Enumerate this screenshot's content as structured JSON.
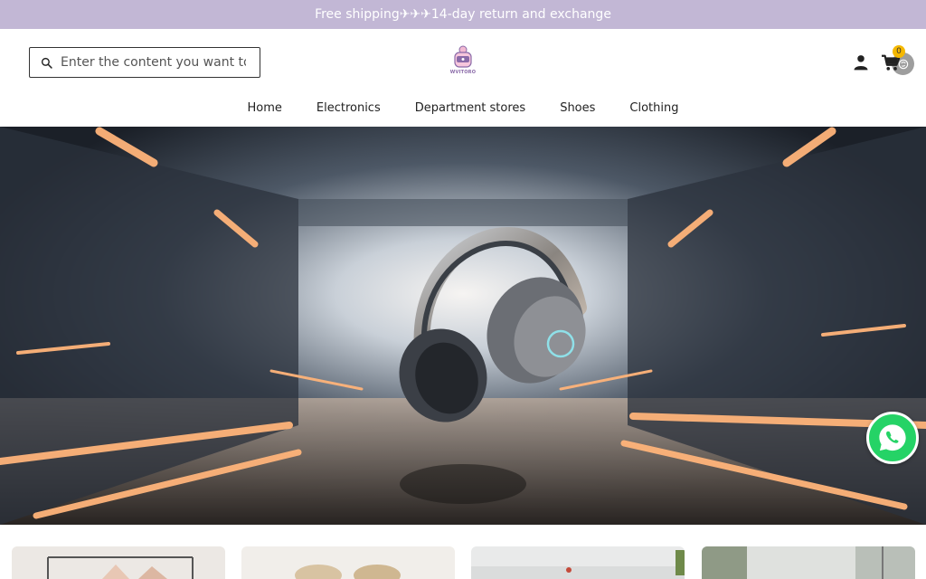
{
  "announcement": "Free shipping✈✈✈14-day return and exchange",
  "search": {
    "placeholder": "Enter the content you want to search"
  },
  "logo": {
    "text": "WVITORO"
  },
  "cart": {
    "count": "0"
  },
  "nav": {
    "items": [
      "Home",
      "Electronics",
      "Department stores",
      "Shoes",
      "Clothing"
    ]
  },
  "icons": {
    "search": "search-icon",
    "user": "user-icon",
    "cart": "cart-icon",
    "whatsapp": "whatsapp-icon",
    "floating": "chat-bubble-icon"
  },
  "colors": {
    "announcement_bg": "#c2b7d5",
    "cart_badge": "#f5b800",
    "whatsapp": "#25d366"
  }
}
